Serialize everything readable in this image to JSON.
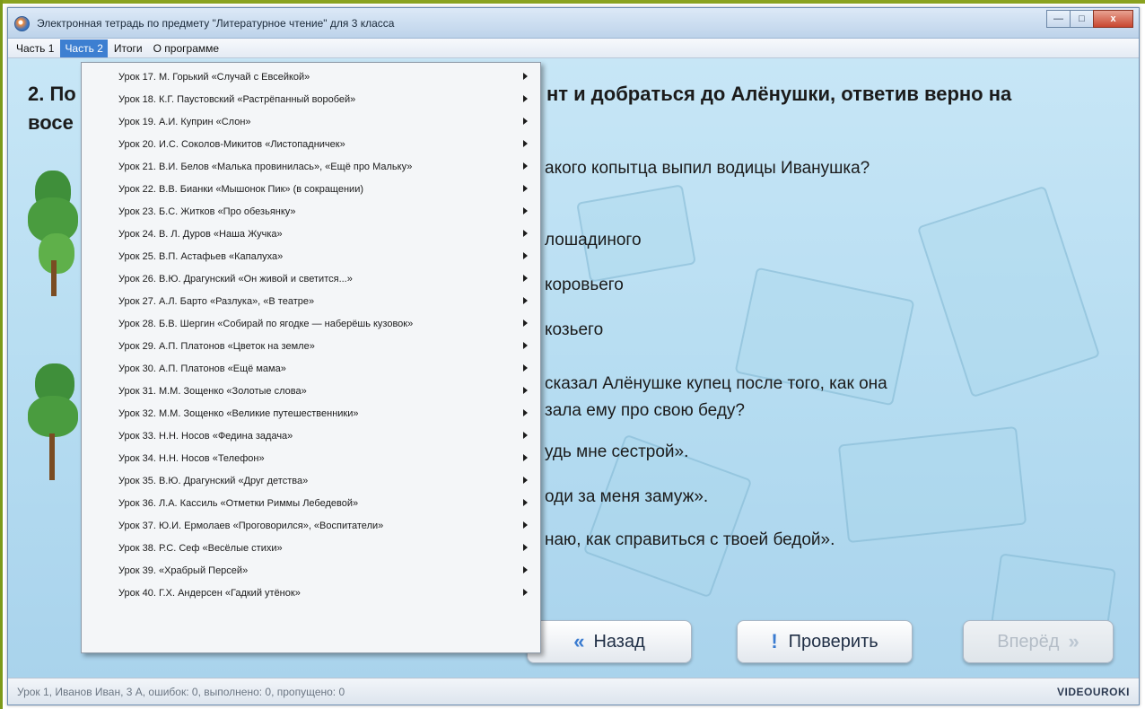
{
  "window": {
    "title": "Электронная тетрадь по предмету \"Литературное чтение\" для 3 класса",
    "buttons": {
      "minimize": "—",
      "maximize": "□",
      "close": "x"
    }
  },
  "menubar": {
    "items": [
      "Часть 1",
      "Часть 2",
      "Итоги",
      "О программе"
    ],
    "active": "Часть 2"
  },
  "question": {
    "title_line1_left": "2. По",
    "title_line1_right": "нт и добраться до Алёнушки, ответив верно на",
    "title_line2_left": "восе",
    "q1": "акого копытца выпил водицы Иванушка?",
    "options1": [
      "лошадиного",
      "коровьего",
      "козьего"
    ],
    "q2_line1": "сказал Алёнушке купец после того, как она",
    "q2_line2": "зала ему про свою беду?",
    "options2": [
      "удь мне сестрой».",
      "оди за меня замуж».",
      "наю, как справиться с твоей бедой»."
    ]
  },
  "nav": {
    "back": "Назад",
    "check": "Проверить",
    "forward": "Вперёд"
  },
  "status": {
    "text": "Урок 1, Иванов Иван, 3 А, ошибок: 0, выполнено: 0, пропущено: 0",
    "brand": "VIDEOUROKI"
  },
  "dropdown": {
    "items": [
      "Урок 17. М. Горький «Случай с Евсейкой»",
      "Урок 18. К.Г. Паустовский «Растрёпанный воробей»",
      "Урок 19. А.И. Куприн «Слон»",
      "Урок 20. И.С. Соколов-Микитов «Листопадничек»",
      "Урок 21. В.И. Белов «Малька провинилась», «Ещё про Мальку»",
      "Урок 22. В.В. Бианки «Мышонок Пик» (в сокращении)",
      "Урок 23. Б.С. Житков «Про обезьянку»",
      "Урок 24. В. Л. Дуров «Наша Жучка»",
      "Урок 25. В.П. Астафьев «Капалуха»",
      "Урок 26. В.Ю. Драгунский «Он живой и светится...»",
      "Урок 27. А.Л. Барто «Разлука», «В театре»",
      "Урок 28. Б.В. Шергин «Собирай по ягодке — наберёшь кузовок»",
      "Урок 29. А.П. Платонов «Цветок на земле»",
      "Урок 30. А.П. Платонов «Ещё мама»",
      "Урок 31. М.М. Зощенко «Золотые слова»",
      "Урок 32. М.М. Зощенко «Великие путешественники»",
      "Урок 33. Н.Н. Носов «Федина задача»",
      "Урок 34. Н.Н. Носов «Телефон»",
      "Урок 35. В.Ю. Драгунский «Друг детства»",
      "Урок 36. Л.А. Кассиль «Отметки Риммы Лебедевой»",
      "Урок 37. Ю.И. Ермолаев «Проговорился», «Воспитатели»",
      "Урок 38. Р.С. Сеф «Весёлые стихи»",
      "Урок 39. «Храбрый Персей»",
      "Урок 40. Г.Х. Андерсен «Гадкий утёнок»"
    ]
  },
  "colors": {
    "menu_active": "#3d7fd1",
    "content_bg": "#b5dcf1",
    "nav_glyph": "#3a7bd0"
  },
  "icons": {
    "back": "double-chevron-left-icon",
    "check": "exclamation-icon",
    "forward": "double-chevron-right-icon",
    "submenu": "triangle-right-icon"
  }
}
